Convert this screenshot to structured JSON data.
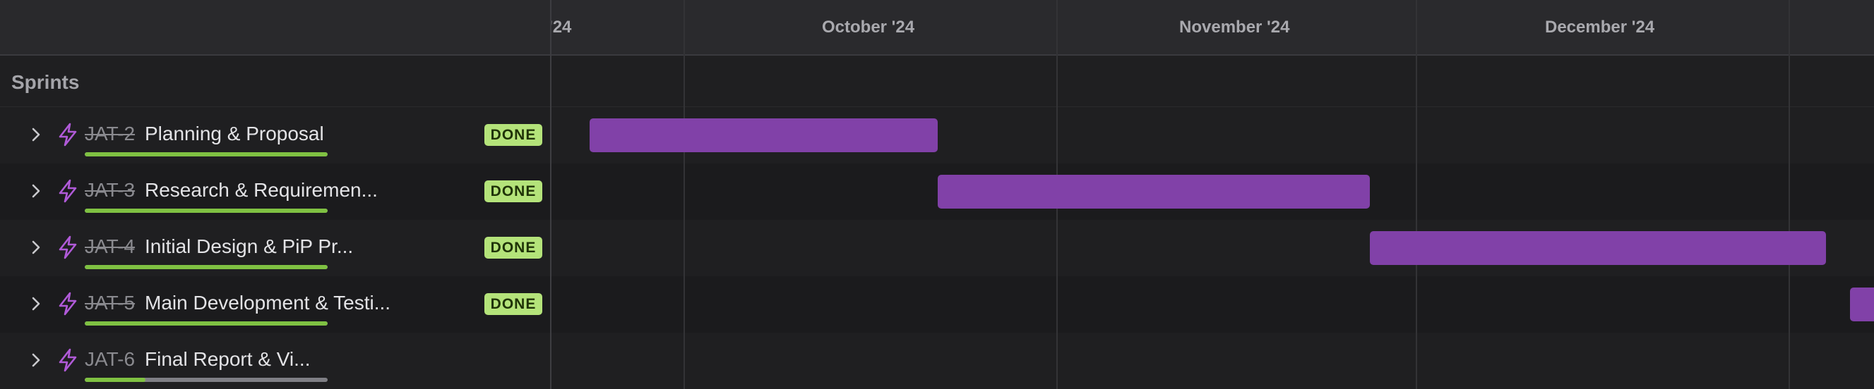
{
  "timeline": {
    "months": [
      "'24",
      "October '24",
      "November '24",
      "December '24"
    ]
  },
  "group": {
    "title": "Sprints"
  },
  "colors": {
    "bar": "#8141a8",
    "done_badge_bg": "#b4e37a",
    "progress_done": "#7fc142",
    "progress_remaining": "#7f7f85",
    "bolt_icon": "#b05ad8"
  },
  "sprints": [
    {
      "key": "JAT-2",
      "title": "Planning & Proposal",
      "status": "DONE",
      "progress": 1.0
    },
    {
      "key": "JAT-3",
      "title": "Research & Requiremen...",
      "status": "DONE",
      "progress": 1.0
    },
    {
      "key": "JAT-4",
      "title": "Initial Design & PiP Pr...",
      "status": "DONE",
      "progress": 1.0
    },
    {
      "key": "JAT-5",
      "title": "Main Development & Testi...",
      "status": "DONE",
      "progress": 1.0
    },
    {
      "key": "JAT-6",
      "title": "Final Report & Vi...",
      "status": "",
      "progress": 0.25
    }
  ]
}
